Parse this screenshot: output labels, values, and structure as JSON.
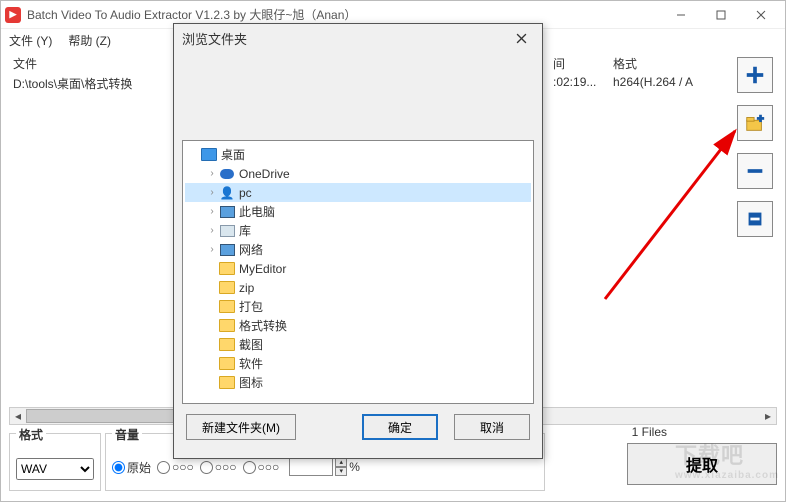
{
  "window": {
    "title": "Batch Video To Audio Extractor V1.2.3 by 大眼仔~旭（Anan）"
  },
  "menu": {
    "file": "文件 (Y)",
    "help": "帮助 (Z)"
  },
  "columns": {
    "file": "文件",
    "time": "间",
    "format": "格式"
  },
  "rows": [
    {
      "file": "D:\\tools\\桌面\\格式转换",
      "time": ":02:19...",
      "format": "h264(H.264 / A"
    }
  ],
  "footer": {
    "files_count": "1 Files",
    "format_label": "格式",
    "format_value": "WAV",
    "volume_label": "音量",
    "radio_original": "原始",
    "pct_symbol": "%",
    "extract": "提取"
  },
  "dialog": {
    "title": "浏览文件夹",
    "new_folder": "新建文件夹(M)",
    "ok": "确定",
    "cancel": "取消",
    "tree": [
      {
        "indent": 0,
        "expander": "",
        "icon": "folder-blue",
        "label": "桌面",
        "selected": false
      },
      {
        "indent": 1,
        "expander": "›",
        "icon": "cloud",
        "label": "OneDrive"
      },
      {
        "indent": 1,
        "expander": "›",
        "icon": "person",
        "label": "pc",
        "selected": true
      },
      {
        "indent": 1,
        "expander": "›",
        "icon": "monitor",
        "label": "此电脑"
      },
      {
        "indent": 1,
        "expander": "›",
        "icon": "drive",
        "label": "库"
      },
      {
        "indent": 1,
        "expander": "›",
        "icon": "monitor",
        "label": "网络"
      },
      {
        "indent": 1,
        "expander": "",
        "icon": "folder",
        "label": "MyEditor"
      },
      {
        "indent": 1,
        "expander": "",
        "icon": "folder",
        "label": "zip"
      },
      {
        "indent": 1,
        "expander": "",
        "icon": "folder",
        "label": "打包"
      },
      {
        "indent": 1,
        "expander": "",
        "icon": "folder",
        "label": "格式转换"
      },
      {
        "indent": 1,
        "expander": "",
        "icon": "folder",
        "label": "截图"
      },
      {
        "indent": 1,
        "expander": "",
        "icon": "folder",
        "label": "软件"
      },
      {
        "indent": 1,
        "expander": "",
        "icon": "folder",
        "label": "图标"
      }
    ]
  },
  "watermark": {
    "big": "下载吧",
    "small": "www.xiazaiba.com"
  }
}
